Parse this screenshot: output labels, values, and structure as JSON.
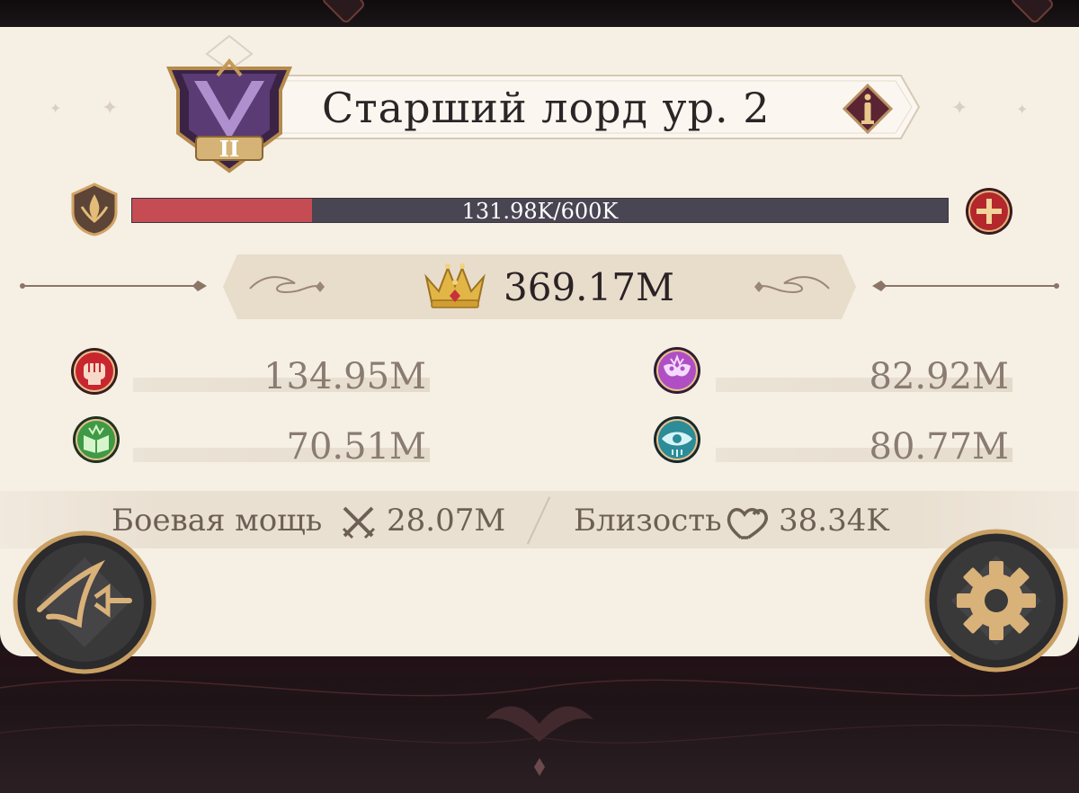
{
  "rank": {
    "title": "Старший лорд ур. 2",
    "emblem_numeral": "II",
    "info_icon": "info-icon"
  },
  "progress": {
    "text": "131.98K/600K",
    "current": 131980,
    "max": 600000,
    "fraction": 0.22
  },
  "total_power": {
    "value": "369.17M",
    "icon": "crown-icon"
  },
  "stats": [
    {
      "icon": "fist-icon",
      "value": "134.95M",
      "color": "#c8262e"
    },
    {
      "icon": "mask-icon",
      "value": "82.92M",
      "color": "#b04fc4"
    },
    {
      "icon": "book-icon",
      "value": "70.51M",
      "color": "#3f9a45"
    },
    {
      "icon": "eye-icon",
      "value": "80.77M",
      "color": "#2c8c98"
    }
  ],
  "footer": {
    "combat_label": "Боевая мощь",
    "combat_value": "28.07M",
    "intimacy_label": "Близость",
    "intimacy_value": "38.34K"
  },
  "colors": {
    "panel": "#f6efe4",
    "accent_red": "#c64c54",
    "gold": "#c9a063",
    "dark": "#1c1416"
  }
}
